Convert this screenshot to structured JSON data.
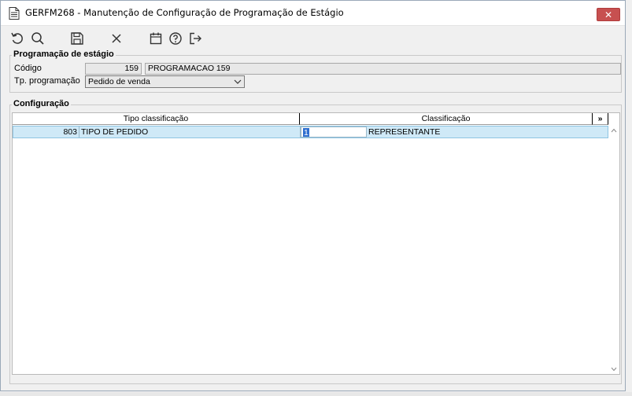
{
  "window": {
    "title": "GERFM268 - Manutenção de Configuração de Programação de Estágio",
    "close_label": "✕"
  },
  "toolbar": {
    "buttons": [
      "refresh",
      "search",
      "save",
      "cancel",
      "calendar",
      "help",
      "exit"
    ]
  },
  "programacao": {
    "group_title": "Programação de estágio",
    "codigo_label": "Código",
    "codigo_value": "159",
    "descricao_value": "PROGRAMACAO 159",
    "tp_label": "Tp. programação",
    "tp_value": "Pedido de venda"
  },
  "configuracao": {
    "group_title": "Configuração",
    "columns": [
      "Tipo classificação",
      "Classificação"
    ],
    "expand_label": "»",
    "rows": [
      {
        "tipo_code": "803",
        "tipo_desc": "TIPO DE PEDIDO",
        "class_code": "1",
        "class_desc": "REPRESENTANTE"
      }
    ]
  },
  "colors": {
    "row_selected": "#cfe9f7",
    "close_button": "#c75050"
  }
}
